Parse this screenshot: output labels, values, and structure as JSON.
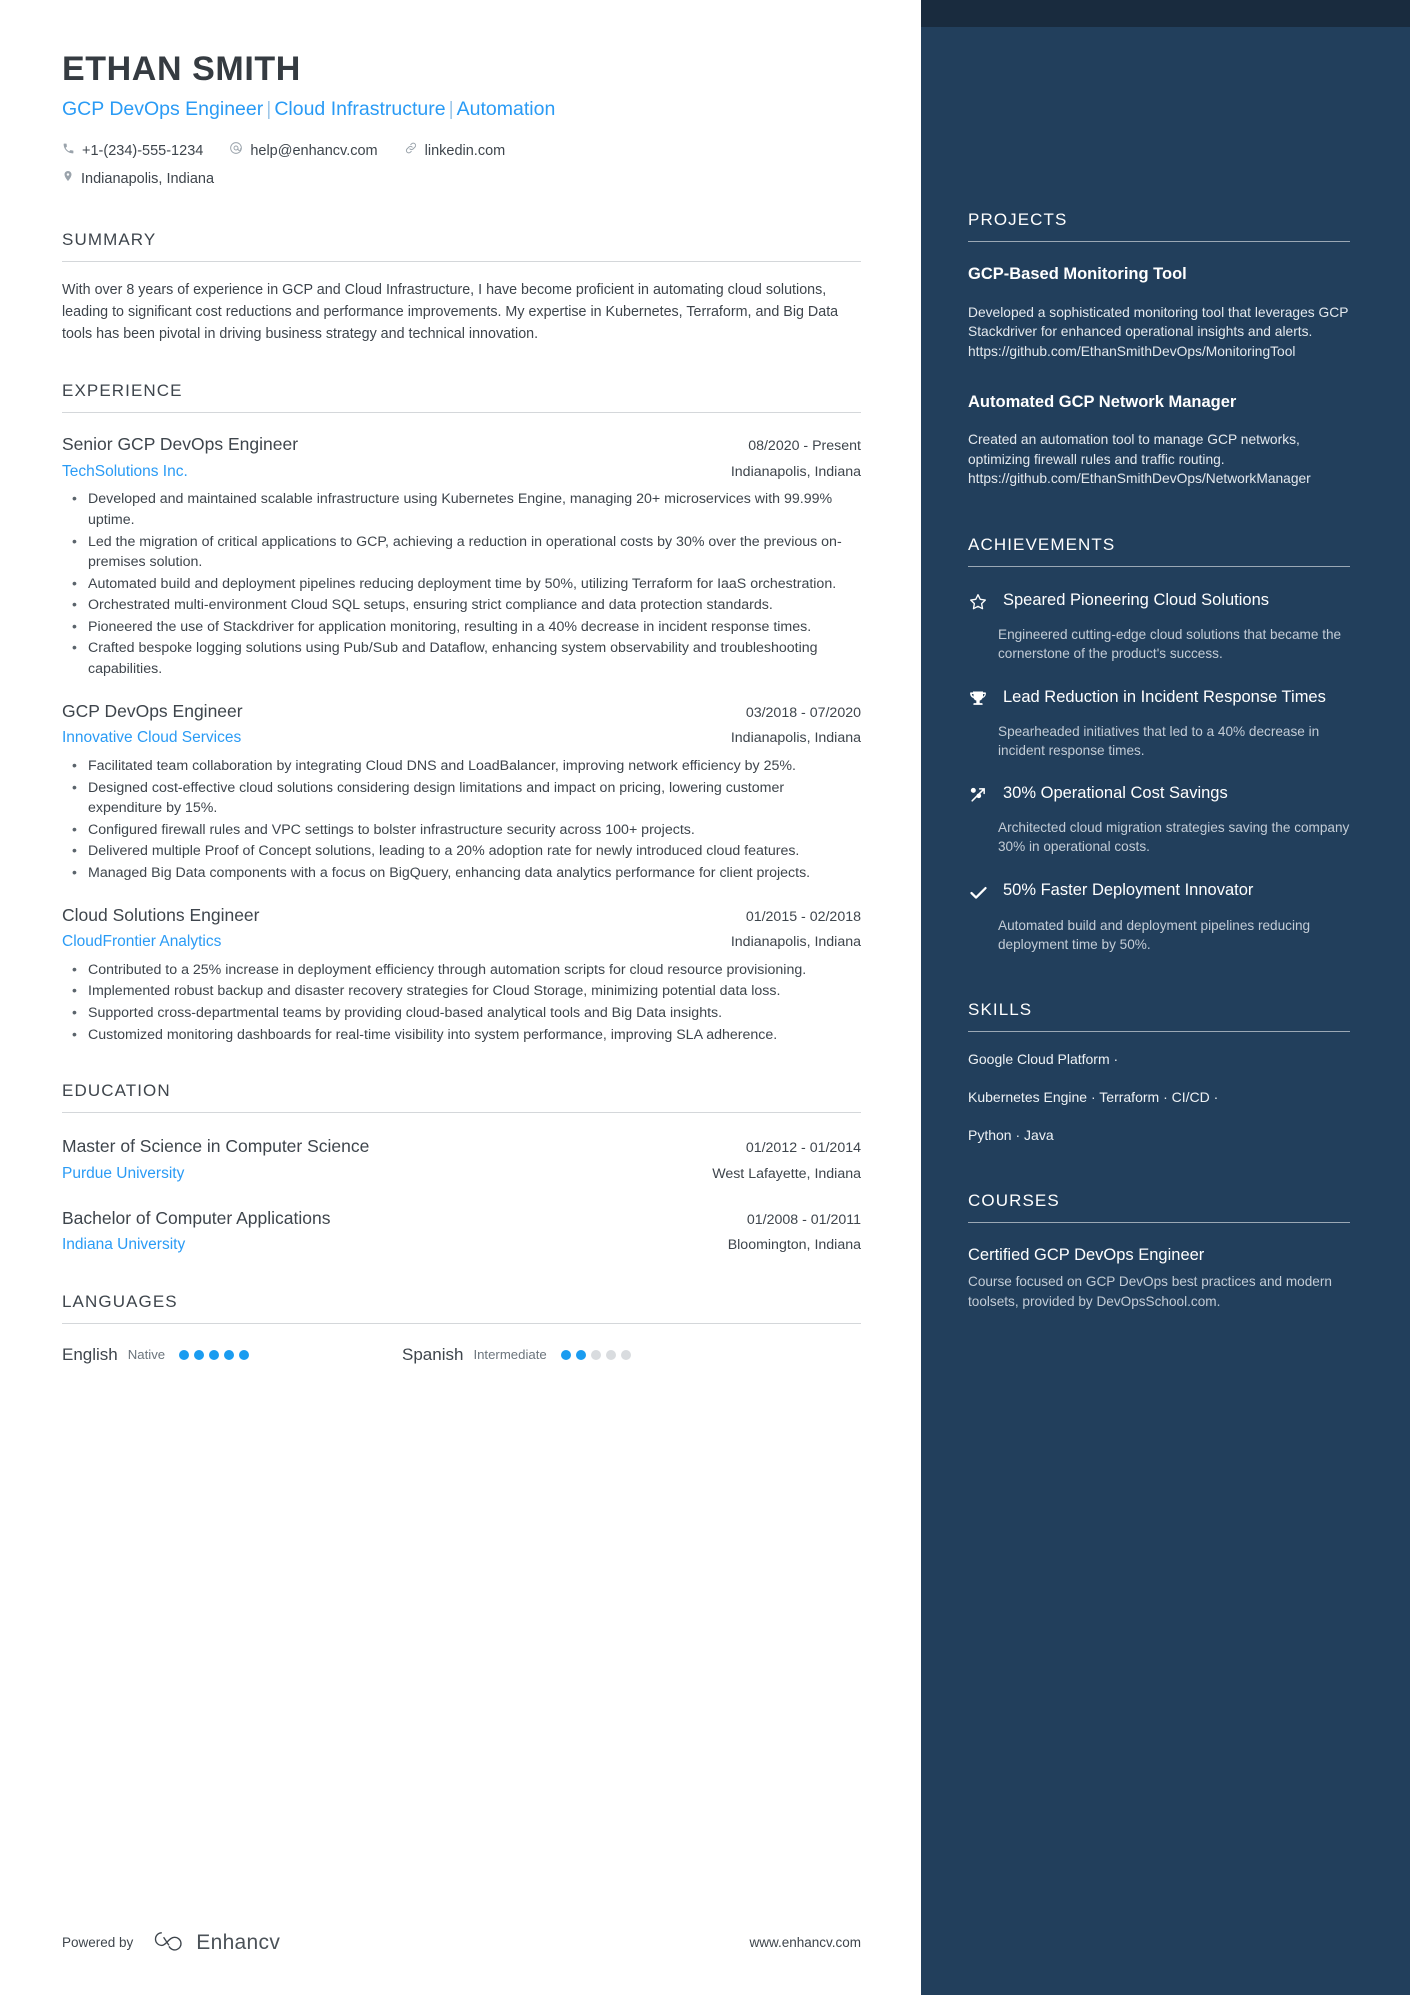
{
  "header": {
    "name": "ETHAN SMITH",
    "headline_parts": [
      "GCP DevOps Engineer",
      "Cloud Infrastructure",
      "Automation"
    ],
    "separator": "|",
    "contact": {
      "phone": "+1-(234)-555-1234",
      "email": "help@enhancv.com",
      "link": "linkedin.com",
      "location": "Indianapolis, Indiana"
    }
  },
  "summary": {
    "heading": "SUMMARY",
    "text": "With over 8 years of experience in GCP and Cloud Infrastructure, I have become proficient in automating cloud solutions, leading to significant cost reductions and performance improvements. My expertise in Kubernetes, Terraform, and Big Data tools has been pivotal in driving business strategy and technical innovation."
  },
  "experience": {
    "heading": "EXPERIENCE",
    "entries": [
      {
        "title": "Senior GCP DevOps Engineer",
        "date": "08/2020 - Present",
        "org": "TechSolutions Inc.",
        "location": "Indianapolis, Indiana",
        "bullets": [
          "Developed and maintained scalable infrastructure using Kubernetes Engine, managing 20+ microservices with 99.99% uptime.",
          "Led the migration of critical applications to GCP, achieving a reduction in operational costs by 30% over the previous on-premises solution.",
          "Automated build and deployment pipelines reducing deployment time by 50%, utilizing Terraform for IaaS orchestration.",
          "Orchestrated multi-environment Cloud SQL setups, ensuring strict compliance and data protection standards.",
          "Pioneered the use of Stackdriver for application monitoring, resulting in a 40% decrease in incident response times.",
          "Crafted bespoke logging solutions using Pub/Sub and Dataflow, enhancing system observability and troubleshooting capabilities."
        ]
      },
      {
        "title": "GCP DevOps Engineer",
        "date": "03/2018 - 07/2020",
        "org": "Innovative Cloud Services",
        "location": "Indianapolis, Indiana",
        "bullets": [
          "Facilitated team collaboration by integrating Cloud DNS and LoadBalancer, improving network efficiency by 25%.",
          "Designed cost-effective cloud solutions considering design limitations and impact on pricing, lowering customer expenditure by 15%.",
          "Configured firewall rules and VPC settings to bolster infrastructure security across 100+ projects.",
          "Delivered multiple Proof of Concept solutions, leading to a 20% adoption rate for newly introduced cloud features.",
          "Managed Big Data components with a focus on BigQuery, enhancing data analytics performance for client projects."
        ]
      },
      {
        "title": "Cloud Solutions Engineer",
        "date": "01/2015 - 02/2018",
        "org": "CloudFrontier Analytics",
        "location": "Indianapolis, Indiana",
        "bullets": [
          "Contributed to a 25% increase in deployment efficiency through automation scripts for cloud resource provisioning.",
          "Implemented robust backup and disaster recovery strategies for Cloud Storage, minimizing potential data loss.",
          "Supported cross-departmental teams by providing cloud-based analytical tools and Big Data insights.",
          "Customized monitoring dashboards for real-time visibility into system performance, improving SLA adherence."
        ]
      }
    ]
  },
  "education": {
    "heading": "EDUCATION",
    "entries": [
      {
        "title": "Master of Science in Computer Science",
        "date": "01/2012 - 01/2014",
        "org": "Purdue University",
        "location": "West Lafayette, Indiana"
      },
      {
        "title": "Bachelor of Computer Applications",
        "date": "01/2008 - 01/2011",
        "org": "Indiana University",
        "location": "Bloomington, Indiana"
      }
    ]
  },
  "languages": {
    "heading": "LANGUAGES",
    "items": [
      {
        "name": "English",
        "level": "Native",
        "filled": 5,
        "total": 5
      },
      {
        "name": "Spanish",
        "level": "Intermediate",
        "filled": 2,
        "total": 5
      }
    ]
  },
  "footer": {
    "powered_by": "Powered by",
    "brand": "Enhancv",
    "site": "www.enhancv.com"
  },
  "sidebar": {
    "projects": {
      "heading": "PROJECTS",
      "items": [
        {
          "title": "GCP-Based Monitoring Tool",
          "desc": "Developed a sophisticated monitoring tool that leverages GCP Stackdriver for enhanced operational insights and alerts. https://github.com/EthanSmithDevOps/MonitoringTool"
        },
        {
          "title": "Automated GCP Network Manager",
          "desc": "Created an automation tool to manage GCP networks, optimizing firewall rules and traffic routing. https://github.com/EthanSmithDevOps/NetworkManager"
        }
      ]
    },
    "achievements": {
      "heading": "ACHIEVEMENTS",
      "items": [
        {
          "icon": "star-icon",
          "title": "Speared Pioneering Cloud Solutions",
          "desc": "Engineered cutting-edge cloud solutions that became the cornerstone of the product's success."
        },
        {
          "icon": "trophy-icon",
          "title": "Lead Reduction in Incident Response Times",
          "desc": "Spearheaded initiatives that led to a 40% decrease in incident response times."
        },
        {
          "icon": "percent-arrow-icon",
          "title": "30% Operational Cost Savings",
          "desc": "Architected cloud migration strategies saving the company 30% in operational costs."
        },
        {
          "icon": "check-icon",
          "title": "50% Faster Deployment Innovator",
          "desc": "Automated build and deployment pipelines reducing deployment time by 50%."
        }
      ]
    },
    "skills": {
      "heading": "SKILLS",
      "lines": [
        "Google Cloud Platform ·",
        "Kubernetes Engine · Terraform · CI/CD ·",
        "Python · Java"
      ]
    },
    "courses": {
      "heading": "COURSES",
      "items": [
        {
          "title": "Certified GCP DevOps Engineer",
          "desc": "Course focused on GCP DevOps best practices and modern toolsets, provided by DevOpsSchool.com."
        }
      ]
    }
  },
  "colors": {
    "accent_blue": "#2A9BF5",
    "sidebar_bg": "#223F5C",
    "sidebar_topbar": "#192B3E",
    "text_dark": "#3E454C"
  }
}
